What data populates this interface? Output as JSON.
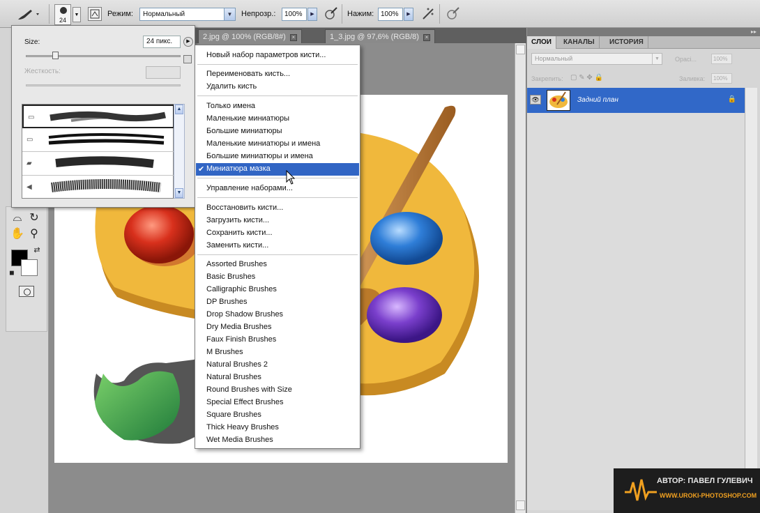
{
  "options_bar": {
    "brush_size": "24",
    "mode_label": "Режим:",
    "mode_value": "Нормальный",
    "opacity_label": "Непрозр.:",
    "opacity_value": "100%",
    "flow_label": "Нажим:",
    "flow_value": "100%"
  },
  "doc_tabs": [
    {
      "label": "2.jpg @ 100% (RGB/8#)",
      "close": "×"
    },
    {
      "label": "1_3.jpg @ 97,6% (RGB/8)",
      "close": "×"
    }
  ],
  "brush_popup": {
    "size_label": "Size:",
    "size_value": "24 пикс.",
    "hardness_label": "Жесткость:",
    "menu_arrow": "▶"
  },
  "context_menu": {
    "groups": [
      [
        "Новый набор параметров кисти..."
      ],
      [
        "Переименовать кисть...",
        "Удалить кисть"
      ],
      [
        "Только имена",
        "Маленькие миниатюры",
        "Большие миниатюры",
        "Маленькие миниатюры и имена",
        "Большие миниатюры и имена",
        "Миниатюра мазка"
      ],
      [
        "Управление наборами..."
      ],
      [
        "Восстановить кисти...",
        "Загрузить кисти...",
        "Сохранить кисти...",
        "Заменить кисти..."
      ],
      [
        "Assorted Brushes",
        "Basic Brushes",
        "Calligraphic Brushes",
        "DP Brushes",
        "Drop Shadow Brushes",
        "Dry Media Brushes",
        "Faux Finish Brushes",
        "M Brushes",
        "Natural Brushes 2",
        "Natural Brushes",
        "Round Brushes with Size",
        "Special Effect Brushes",
        "Square Brushes",
        "Thick Heavy Brushes",
        "Wet Media Brushes"
      ]
    ],
    "checked_item": "Миниатюра мазка",
    "check_glyph": "✔"
  },
  "right_panel": {
    "tabs": [
      "СЛОИ",
      "КАНАЛЫ",
      "ИСТОРИЯ"
    ],
    "active_tab": "СЛОИ",
    "blend_mode": "Нормальный",
    "opacity_label": "Opaci...",
    "opacity_value": "100%",
    "lock_label": "Закрепить:",
    "fill_label": "Заливка:",
    "fill_value": "100%",
    "layer_name": "Задний план"
  },
  "watermark": {
    "author": "АВТОР: ПАВЕЛ ГУЛЕВИЧ",
    "site": "WWW.UROKI-PHOTOSHOP.COM"
  },
  "colors": {
    "selection": "#3165c4",
    "layer_selected": "#3168c8",
    "watermark_accent": "#f0a020"
  }
}
